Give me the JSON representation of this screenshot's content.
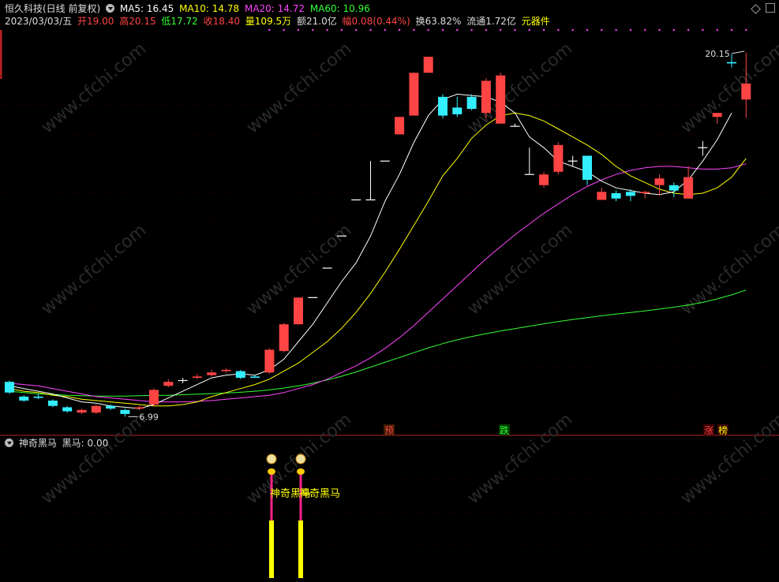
{
  "header": {
    "title": "恒久科技(日线 前复权)",
    "ma5": "MA5: 16.45",
    "ma10": "MA10: 14.78",
    "ma20": "MA20: 14.72",
    "ma60": "MA60: 10.96",
    "colors": {
      "ma5": "#ffffff",
      "ma10": "#ffff00",
      "ma20": "#ff44ff",
      "ma60": "#33ff33"
    }
  },
  "info": {
    "date": "2023/03/03/五",
    "open": "开19.00",
    "high": "高20.15",
    "low": "低17.72",
    "close": "收18.40",
    "volume": "量109.5万",
    "amount": "额21.0亿",
    "change": "幅0.08(0.44%)",
    "turnover": "换63.82%",
    "float": "流通1.72亿",
    "sector": "元器件"
  },
  "price_labels": {
    "high": "20.15",
    "low": "6.99"
  },
  "markers": [
    "预",
    "跌",
    "涨",
    "榜"
  ],
  "indicator": {
    "title": "神奇黑马",
    "value": "黑马: 0.00",
    "signal_label_1": "神奇黑马",
    "signal_label_2": "神奇黑马"
  },
  "watermark": "www.cfchi.com",
  "chart_data": {
    "type": "candlestick",
    "ohlc": [
      [
        7.85,
        7.45,
        7.9,
        7.4
      ],
      [
        7.3,
        7.15,
        7.35,
        7.1
      ],
      [
        7.3,
        7.25,
        7.4,
        7.2
      ],
      [
        7.15,
        6.95,
        7.2,
        6.9
      ],
      [
        6.9,
        6.75,
        6.95,
        6.7
      ],
      [
        6.7,
        6.8,
        6.85,
        6.65
      ],
      [
        6.7,
        6.95,
        7.0,
        6.65
      ],
      [
        6.95,
        6.85,
        7.0,
        6.8
      ],
      [
        6.8,
        6.65,
        6.85,
        6.55
      ],
      [
        6.85,
        6.9,
        6.95,
        6.8
      ],
      [
        7.0,
        7.55,
        7.6,
        6.95
      ],
      [
        7.7,
        7.85,
        7.95,
        7.65
      ],
      [
        7.9,
        7.9,
        8.0,
        7.8
      ],
      [
        8.0,
        8.05,
        8.15,
        7.95
      ],
      [
        8.1,
        8.2,
        8.3,
        8.05
      ],
      [
        8.25,
        8.3,
        8.35,
        8.2
      ],
      [
        8.25,
        8.0,
        8.3,
        7.95
      ],
      [
        8.05,
        8.0,
        8.1,
        8.0
      ],
      [
        8.2,
        9.05,
        9.1,
        8.15
      ],
      [
        9.0,
        10.0,
        10.05,
        8.95
      ],
      [
        10.0,
        11.0,
        11.0,
        10.0
      ],
      [
        11.0,
        11.0,
        11.0,
        11.0
      ],
      [
        12.1,
        12.1,
        12.1,
        12.1
      ],
      [
        13.3,
        13.3,
        13.3,
        13.3
      ],
      [
        14.65,
        14.65,
        14.65,
        14.65
      ],
      [
        14.65,
        14.65,
        16.1,
        14.65
      ],
      [
        16.1,
        16.1,
        16.1,
        16.1
      ],
      [
        17.1,
        17.75,
        17.75,
        17.1
      ],
      [
        17.8,
        19.4,
        19.4,
        18.15
      ],
      [
        19.4,
        20.0,
        20.0,
        20.0
      ],
      [
        18.5,
        17.8,
        18.6,
        17.7
      ],
      [
        18.1,
        17.85,
        18.5,
        17.75
      ],
      [
        18.5,
        18.05,
        18.6,
        18.0
      ],
      [
        17.9,
        19.1,
        19.2,
        17.7
      ],
      [
        17.5,
        19.3,
        19.4,
        17.5
      ],
      [
        17.4,
        17.4,
        17.5,
        17.4
      ],
      [
        15.6,
        15.6,
        16.6,
        15.6
      ],
      [
        15.2,
        15.6,
        15.7,
        15.1
      ],
      [
        15.7,
        16.7,
        16.8,
        15.6
      ],
      [
        16.1,
        16.1,
        16.3,
        15.9
      ],
      [
        16.3,
        15.4,
        16.3,
        15.2
      ],
      [
        14.65,
        14.95,
        15.1,
        14.65
      ],
      [
        14.9,
        14.7,
        15.0,
        14.6
      ],
      [
        14.95,
        14.8,
        15.05,
        14.6
      ],
      [
        14.9,
        14.95,
        15.0,
        14.7
      ],
      [
        15.2,
        15.45,
        15.6,
        14.8
      ],
      [
        15.2,
        15.0,
        15.3,
        14.75
      ],
      [
        14.7,
        15.5,
        15.9,
        14.7
      ],
      [
        16.6,
        16.6,
        16.85,
        16.3
      ],
      [
        17.75,
        17.9,
        17.9,
        17.5
      ],
      [
        19.8,
        19.75,
        20.1,
        19.6
      ],
      [
        18.4,
        19.0,
        20.15,
        17.72
      ]
    ],
    "ma5": [
      7.7,
      7.6,
      7.5,
      7.4,
      7.25,
      7.1,
      7.05,
      6.95,
      6.9,
      6.85,
      7.0,
      7.25,
      7.5,
      7.75,
      8.0,
      8.1,
      8.15,
      8.1,
      8.3,
      8.7,
      9.35,
      10.0,
      10.8,
      11.6,
      12.3,
      13.3,
      14.6,
      15.6,
      16.8,
      17.8,
      18.4,
      18.6,
      18.55,
      18.5,
      18.3,
      17.9,
      17.0,
      16.6,
      16.1,
      15.9,
      15.7,
      15.35,
      15.1,
      15.0,
      14.9,
      14.85,
      14.95,
      15.4,
      16.1,
      16.9,
      17.9
    ],
    "ma10": [
      7.6,
      7.5,
      7.45,
      7.35,
      7.3,
      7.2,
      7.15,
      7.1,
      7.05,
      7.0,
      6.95,
      6.95,
      7.0,
      7.1,
      7.3,
      7.45,
      7.6,
      7.75,
      7.95,
      8.25,
      8.55,
      8.95,
      9.35,
      9.85,
      10.45,
      11.15,
      11.95,
      12.8,
      13.7,
      14.6,
      15.55,
      16.2,
      16.95,
      17.45,
      17.8,
      17.9,
      17.8,
      17.6,
      17.3,
      17.0,
      16.7,
      16.35,
      15.9,
      15.55,
      15.3,
      15.05,
      14.9,
      14.85,
      14.9,
      15.1,
      15.5,
      16.2
    ],
    "ma20": [
      7.8,
      7.75,
      7.7,
      7.6,
      7.5,
      7.4,
      7.3,
      7.25,
      7.2,
      7.15,
      7.1,
      7.1,
      7.1,
      7.12,
      7.15,
      7.2,
      7.25,
      7.3,
      7.35,
      7.45,
      7.6,
      7.75,
      7.95,
      8.2,
      8.45,
      8.75,
      9.1,
      9.5,
      9.95,
      10.45,
      10.95,
      11.45,
      11.95,
      12.45,
      12.9,
      13.35,
      13.75,
      14.15,
      14.5,
      14.85,
      15.15,
      15.4,
      15.6,
      15.75,
      15.85,
      15.9,
      15.9,
      15.85,
      15.8,
      15.8,
      15.85,
      16.0
    ],
    "ma60": [
      7.5,
      7.45,
      7.4,
      7.38,
      7.35,
      7.33,
      7.32,
      7.32,
      7.32,
      7.33,
      7.34,
      7.35,
      7.37,
      7.39,
      7.41,
      7.43,
      7.46,
      7.5,
      7.55,
      7.62,
      7.7,
      7.8,
      7.92,
      8.06,
      8.22,
      8.4,
      8.58,
      8.76,
      8.94,
      9.12,
      9.28,
      9.42,
      9.54,
      9.65,
      9.75,
      9.84,
      9.93,
      10.02,
      10.1,
      10.18,
      10.25,
      10.32,
      10.38,
      10.44,
      10.5,
      10.57,
      10.64,
      10.72,
      10.82,
      10.95,
      11.1,
      11.28
    ],
    "signals_at_index": [
      18,
      20
    ]
  }
}
